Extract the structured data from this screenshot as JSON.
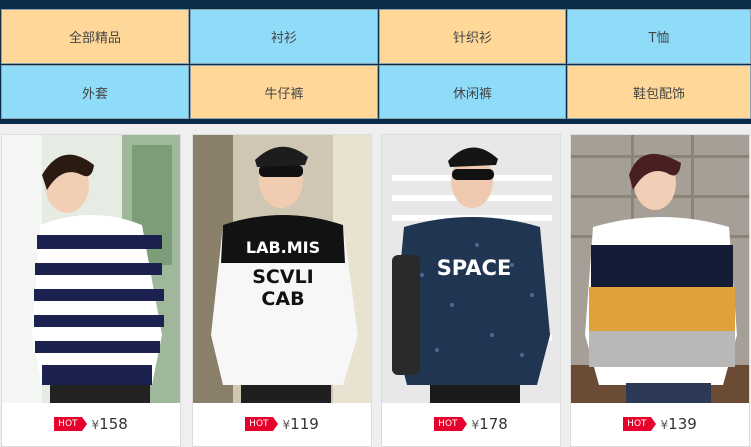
{
  "categories": [
    {
      "label": "全部精品",
      "color": "#ffd899"
    },
    {
      "label": "衬衫",
      "color": "#8fdcf8"
    },
    {
      "label": "针织衫",
      "color": "#ffd899"
    },
    {
      "label": "T恤",
      "color": "#8fdcf8"
    },
    {
      "label": "外套",
      "color": "#8fdcf8"
    },
    {
      "label": "牛仔裤",
      "color": "#ffd899"
    },
    {
      "label": "休闲裤",
      "color": "#8fdcf8"
    },
    {
      "label": "鞋包配饰",
      "color": "#ffd899"
    }
  ],
  "products": [
    {
      "badge": "HOT",
      "currency": "¥",
      "price": "158",
      "shirt_text": ""
    },
    {
      "badge": "HOT",
      "currency": "¥",
      "price": "119",
      "shirt_text": "LAB.MIS SCVLI CAB"
    },
    {
      "badge": "HOT",
      "currency": "¥",
      "price": "178",
      "shirt_text": "SPACE"
    },
    {
      "badge": "HOT",
      "currency": "¥",
      "price": "139",
      "shirt_text": ""
    }
  ],
  "colors": {
    "accent": "#e8002d",
    "nav_dark": "#0c2d4a"
  }
}
